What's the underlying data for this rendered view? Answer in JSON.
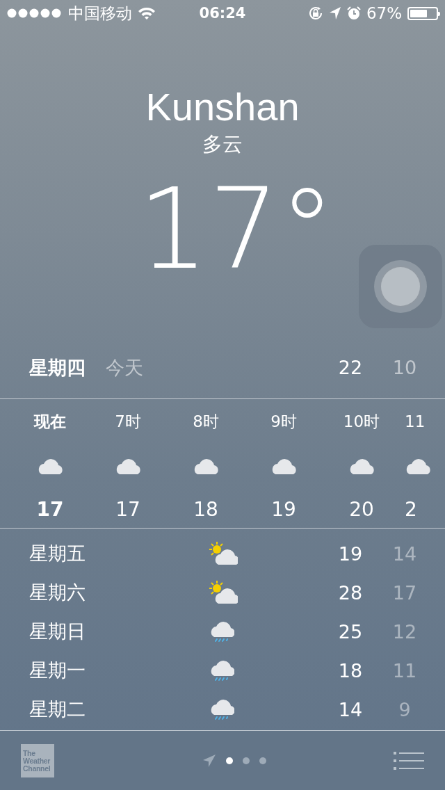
{
  "status_bar": {
    "carrier": "中国移动",
    "time": "06:24",
    "battery": "67%"
  },
  "location": {
    "city": "Kunshan",
    "condition": "多云",
    "temperature": "17°"
  },
  "today": {
    "day": "星期四",
    "label": "今天",
    "high": "22",
    "low": "10"
  },
  "hourly": [
    {
      "time": "现在",
      "kind": "cloudy",
      "temp": "17",
      "selected": true
    },
    {
      "time": "7时",
      "kind": "cloudy",
      "temp": "17",
      "selected": false
    },
    {
      "time": "8时",
      "kind": "cloudy",
      "temp": "18",
      "selected": false
    },
    {
      "time": "9时",
      "kind": "cloudy",
      "temp": "19",
      "selected": false
    },
    {
      "time": "10时",
      "kind": "cloudy",
      "temp": "20",
      "selected": false
    },
    {
      "time": "11",
      "kind": "cloudy",
      "temp": "2",
      "selected": false
    }
  ],
  "daily": [
    {
      "day": "星期五",
      "kind": "partly-cloudy",
      "high": "19",
      "low": "14"
    },
    {
      "day": "星期六",
      "kind": "partly-cloudy",
      "high": "28",
      "low": "17"
    },
    {
      "day": "星期日",
      "kind": "rain",
      "high": "25",
      "low": "12"
    },
    {
      "day": "星期一",
      "kind": "rain",
      "high": "18",
      "low": "11"
    },
    {
      "day": "星期二",
      "kind": "rain",
      "high": "14",
      "low": "9"
    }
  ],
  "bottom_bar": {
    "logo": "The Weather Channel",
    "pages": [
      {
        "selected": true
      },
      {
        "selected": false
      },
      {
        "selected": false
      }
    ]
  }
}
